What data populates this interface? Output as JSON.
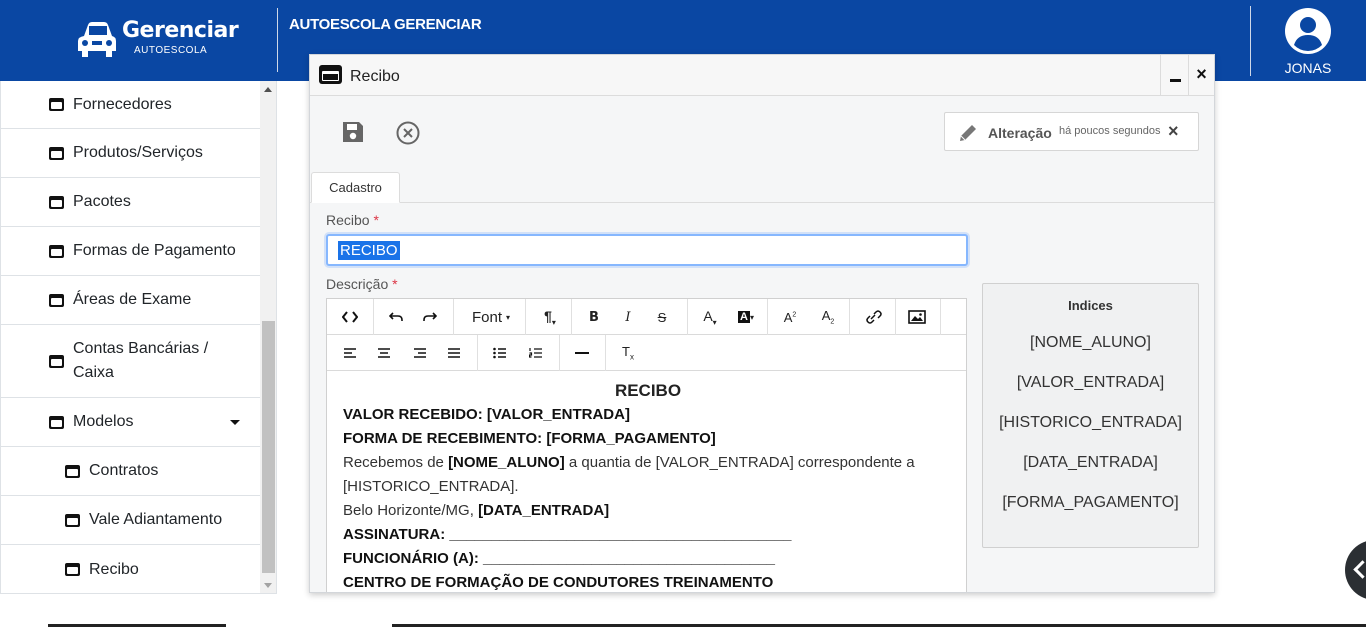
{
  "header": {
    "brand": "Gerenciar",
    "brand_sub": "AUTOESCOLA",
    "title": "AUTOESCOLA GERENCIAR",
    "user_name": "JONAS"
  },
  "sidebar": {
    "items": [
      {
        "label": "Fornecedores"
      },
      {
        "label": "Produtos/Serviços"
      },
      {
        "label": "Pacotes"
      },
      {
        "label": "Formas de Pagamento"
      },
      {
        "label": "Áreas de Exame"
      },
      {
        "label": "Contas Bancárias / Caixa"
      },
      {
        "label": "Modelos"
      },
      {
        "label": "Contratos"
      },
      {
        "label": "Vale Adiantamento"
      },
      {
        "label": "Recibo"
      }
    ]
  },
  "modal": {
    "title": "Recibo",
    "minimize": "_",
    "close": "×",
    "alteracao_label": "Alteração",
    "alteracao_time": "há poucos segundos",
    "alteracao_close": "×",
    "tab_label": "Cadastro",
    "recibo_label": "Recibo",
    "recibo_value": "RECIBO",
    "descricao_label": "Descrição",
    "required_mark": "*"
  },
  "editor": {
    "font_label": "Font",
    "content": {
      "heading": "RECIBO",
      "line1": "VALOR RECEBIDO: [VALOR_ENTRADA]",
      "line2": "FORMA DE RECEBIMENTO: [FORMA_PAGAMENTO]",
      "line3_a": "Recebemos de ",
      "line3_b": "[NOME_ALUNO]",
      "line3_c": " a quantia de [VALOR_ENTRADA] correspondente a [HISTORICO_ENTRADA].",
      "line4_a": "Belo Horizonte/MG, ",
      "line4_b": "[DATA_ENTRADA]",
      "line5": "ASSINATURA: _________________________________________",
      "line6": "FUNCIONÁRIO (A): ___________________________________",
      "line7": "CENTRO DE FORMAÇÃO DE CONDUTORES TREINAMENTO"
    }
  },
  "indices": {
    "title": "Indices",
    "items": [
      "[NOME_ALUNO]",
      "[VALOR_ENTRADA]",
      "[HISTORICO_ENTRADA]",
      "[DATA_ENTRADA]",
      "[FORMA_PAGAMENTO]"
    ]
  },
  "colors": {
    "header_bg": "#0a47a3",
    "selection": "#1a73e8"
  }
}
